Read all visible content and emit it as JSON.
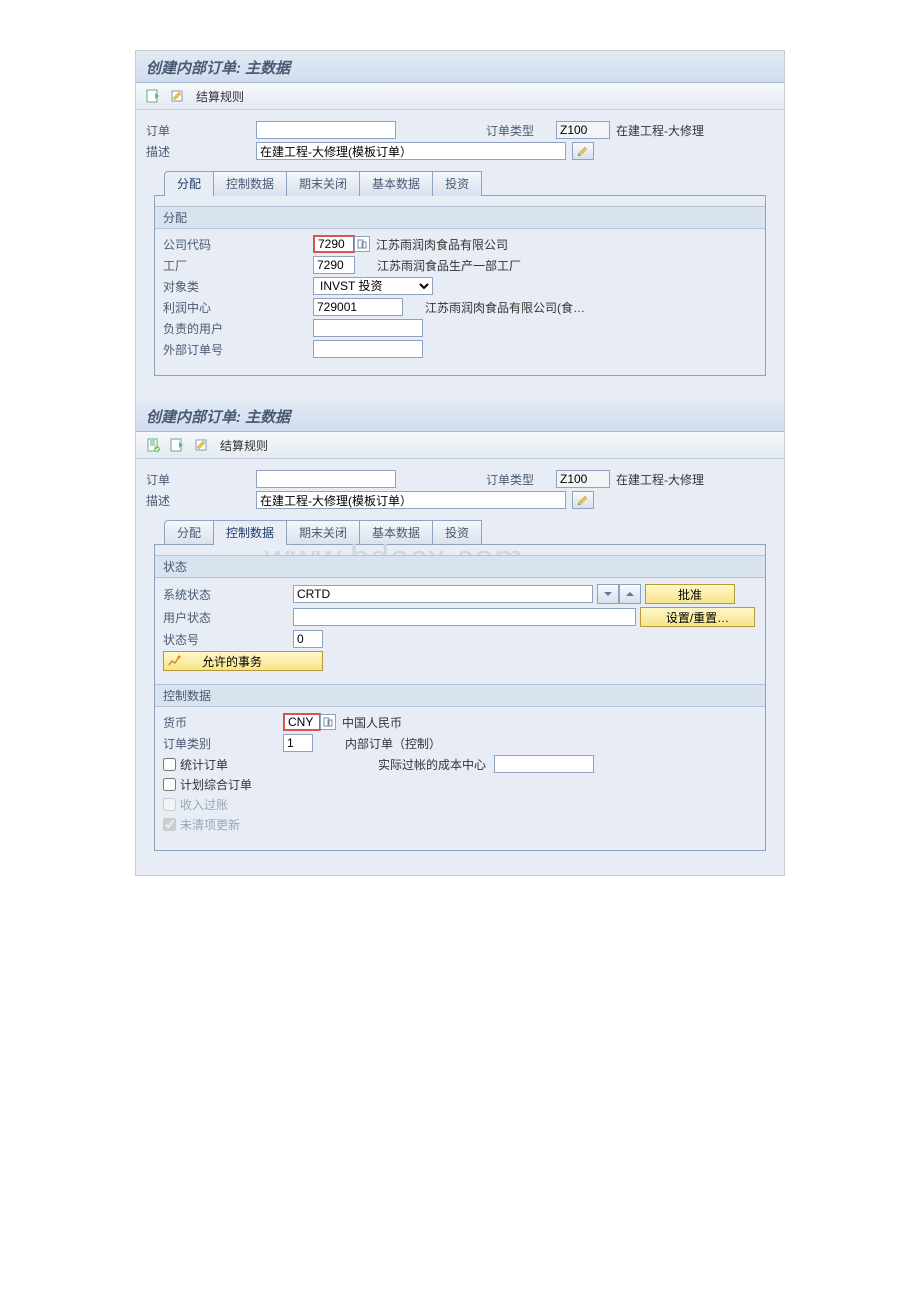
{
  "watermark": "www.bdocx.com",
  "screen1": {
    "title": "创建内部订单: 主数据",
    "toolbar": {
      "settlement_rule": "结算规则"
    },
    "header": {
      "order_label": "订单",
      "order_value": "",
      "order_type_label": "订单类型",
      "order_type_value": "Z100",
      "order_type_text": "在建工程-大修理",
      "desc_label": "描述",
      "desc_value": "在建工程-大修理(模板订单）"
    },
    "tabs": {
      "t1": "分配",
      "t2": "控制数据",
      "t3": "期末关闭",
      "t4": "基本数据",
      "t5": "投资"
    },
    "assign": {
      "group_title": "分配",
      "company_code_label": "公司代码",
      "company_code_value": "7290",
      "company_code_text": "江苏雨润肉食品有限公司",
      "plant_label": "工厂",
      "plant_value": "7290",
      "plant_text": "江苏雨润食品生产一部工厂",
      "object_class_label": "对象类",
      "object_class_value": "INVST 投资",
      "profit_center_label": "利润中心",
      "profit_center_value": "729001",
      "profit_center_text": "江苏雨润肉食品有限公司(食…",
      "responsible_user_label": "负责的用户",
      "responsible_user_value": "",
      "ext_order_label": "外部订单号",
      "ext_order_value": ""
    }
  },
  "screen2": {
    "title": "创建内部订单: 主数据",
    "toolbar": {
      "settlement_rule": "结算规则"
    },
    "header": {
      "order_label": "订单",
      "order_value": "",
      "order_type_label": "订单类型",
      "order_type_value": "Z100",
      "order_type_text": "在建工程-大修理",
      "desc_label": "描述",
      "desc_value": "在建工程-大修理(模板订单）"
    },
    "tabs": {
      "t1": "分配",
      "t2": "控制数据",
      "t3": "期末关闭",
      "t4": "基本数据",
      "t5": "投资"
    },
    "status": {
      "group_title": "状态",
      "system_status_label": "系统状态",
      "system_status_value": "CRTD",
      "user_status_label": "用户状态",
      "user_status_value": "",
      "status_no_label": "状态号",
      "status_no_value": "0",
      "approve_btn": "批准",
      "set_reset_btn": "设置/重置…",
      "allowed_trans_btn": "允许的事务"
    },
    "control": {
      "group_title": "控制数据",
      "currency_label": "货币",
      "currency_value": "CNY",
      "currency_text": "中国人民币",
      "order_cat_label": "订单类别",
      "order_cat_value": "1",
      "order_cat_text": "内部订单（控制）",
      "stat_order_label": "统计订单",
      "actual_cost_center_label": "实际过帐的成本中心",
      "actual_cost_center_value": "",
      "plan_integ_label": "计划综合订单",
      "rev_posting_label": "收入过账",
      "open_item_label": "未清项更新"
    }
  }
}
